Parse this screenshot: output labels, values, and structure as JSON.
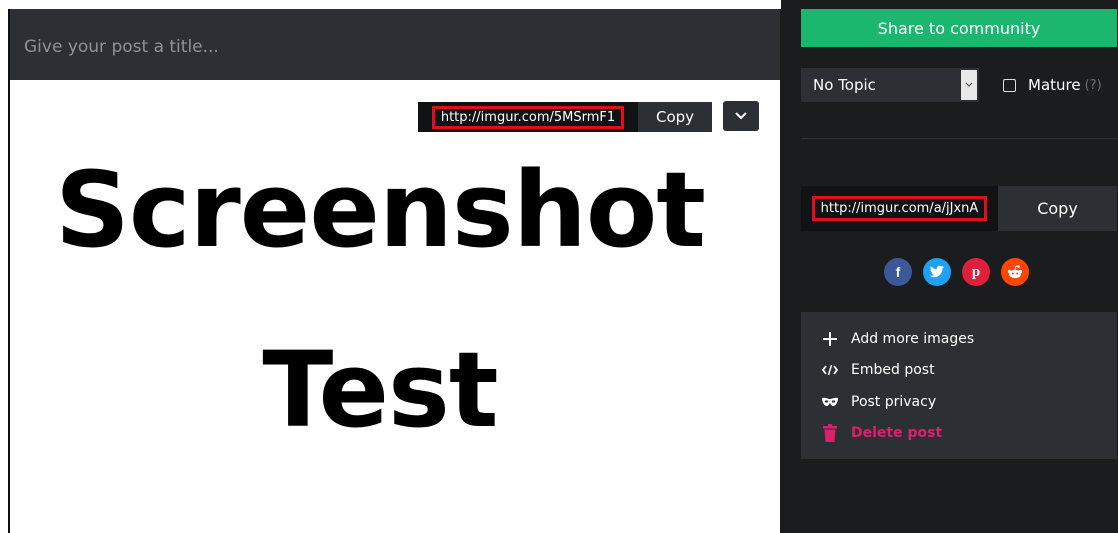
{
  "title_input": {
    "placeholder": "Give your post a title..."
  },
  "image": {
    "line1": "Screenshot",
    "line2": "Test"
  },
  "image_link": {
    "url": "http://imgur.com/5MSrmF1",
    "copy_label": "Copy"
  },
  "share": {
    "label": "Share to community"
  },
  "topic": {
    "selected": "No Topic"
  },
  "mature": {
    "label": "Mature",
    "help": "(?)"
  },
  "album_link": {
    "url": "http://imgur.com/a/jJxnA",
    "copy_label": "Copy"
  },
  "social": [
    {
      "name": "facebook",
      "color": "#3b5998",
      "glyph": "f"
    },
    {
      "name": "twitter",
      "color": "#1da1f2"
    },
    {
      "name": "pinterest",
      "color": "#e0203a",
      "glyph": "p"
    },
    {
      "name": "reddit",
      "color": "#ff4500"
    }
  ],
  "menu": {
    "add_images": "Add more images",
    "embed": "Embed post",
    "privacy": "Post privacy",
    "delete": "Delete post"
  },
  "colors": {
    "accent_green": "#1bb76e",
    "delete_pink": "#e01e6e",
    "highlight_red": "#e00f1b"
  }
}
